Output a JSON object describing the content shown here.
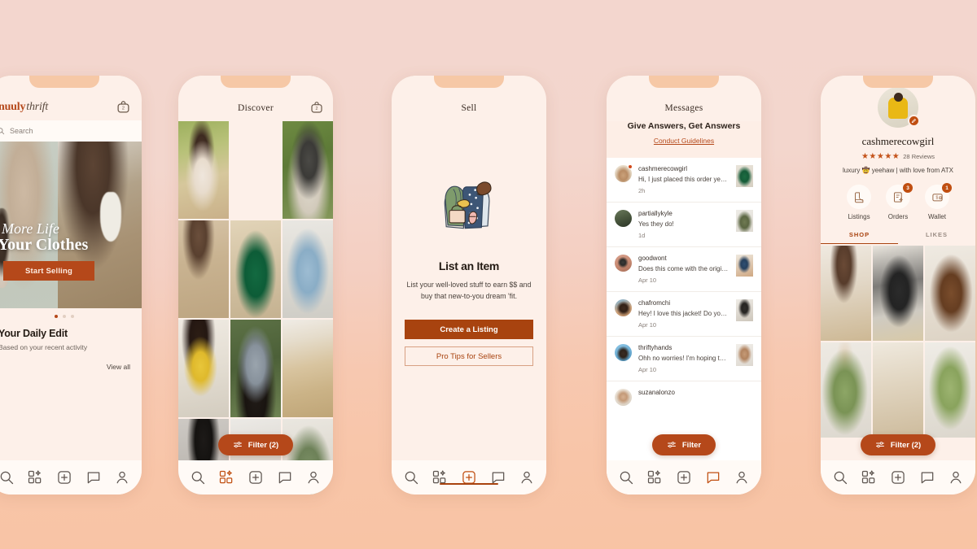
{
  "background": {
    "top_color": "#f3d6ce",
    "bottom_color": "#f8c4a4"
  },
  "brand": {
    "accent": "#b5481a",
    "accent_dark": "#a8430f",
    "surface": "#fdf0e9",
    "card": "#fffaf6"
  },
  "nav_icons": [
    "search-icon",
    "discover-icon",
    "plus-icon",
    "message-icon",
    "profile-icon"
  ],
  "phones": [
    {
      "id": "home",
      "logo_primary": "nuuly",
      "logo_secondary": "thrift",
      "bag_icon": "shopping-bag-icon",
      "search_placeholder": "Search",
      "hero": {
        "line1": "More Life",
        "line2": "in Your Clothes",
        "cta": "Start Selling",
        "dots": 3,
        "active_dot": 0
      },
      "daily": {
        "heading": "Your Daily Edit",
        "subheading": "Based on your recent activity",
        "view_all": "View all"
      },
      "active_tab": -1
    },
    {
      "id": "discover",
      "title": "Discover",
      "bag_icon": "shopping-bag-icon",
      "filter_label": "Filter (2)",
      "filter_icon": "sliders-icon",
      "active_tab": 1
    },
    {
      "id": "sell",
      "title": "Sell",
      "heading": "List an Item",
      "body": "List your well-loved stuff to earn $$ and buy that new-to-you dream 'fit.",
      "primary_cta": "Create a Listing",
      "secondary_cta": "Pro Tips for Sellers",
      "active_tab": 2
    },
    {
      "id": "messages",
      "title": "Messages",
      "banner_heading": "Give Answers, Get Answers",
      "banner_link": "Conduct Guidelines",
      "filter_label": "Filter",
      "filter_icon": "sliders-icon",
      "active_tab": 3,
      "threads": [
        {
          "user": "cashmerecowgirl",
          "preview": "Hi, I just placed this order yesterda…",
          "time": "2h",
          "unread": true
        },
        {
          "user": "partiallykyle",
          "preview": "Yes they do!",
          "time": "1d",
          "unread": false
        },
        {
          "user": "goodwont",
          "preview": "Does this come with the original t…",
          "time": "Apr 10",
          "unread": false
        },
        {
          "user": "chafromchi",
          "preview": "Hey! I love this jacket! Do you hav…",
          "time": "Apr 10",
          "unread": false
        },
        {
          "user": "thriftyhands",
          "preview": "Ohh no worries! I'm hoping to wea…",
          "time": "Apr 10",
          "unread": false
        },
        {
          "user": "suzanalonzo",
          "preview": "",
          "time": "",
          "unread": false
        }
      ]
    },
    {
      "id": "profile",
      "username": "cashmerecowgirl",
      "stars": "★★★★★",
      "reviews": "28 Reviews",
      "bio": "luxury 🤠 yeehaw | with love from ATX",
      "edit_icon": "edit-pencil-icon",
      "actions": [
        {
          "label": "Listings",
          "icon": "boot-icon",
          "badge": ""
        },
        {
          "label": "Orders",
          "icon": "receipt-icon",
          "badge": "3"
        },
        {
          "label": "Wallet",
          "icon": "wallet-icon",
          "badge": "1"
        }
      ],
      "tabs": [
        {
          "label": "SHOP",
          "active": true
        },
        {
          "label": "LIKES",
          "active": false
        }
      ],
      "filter_label": "Filter (2)",
      "filter_icon": "sliders-icon",
      "active_tab": 4
    }
  ]
}
